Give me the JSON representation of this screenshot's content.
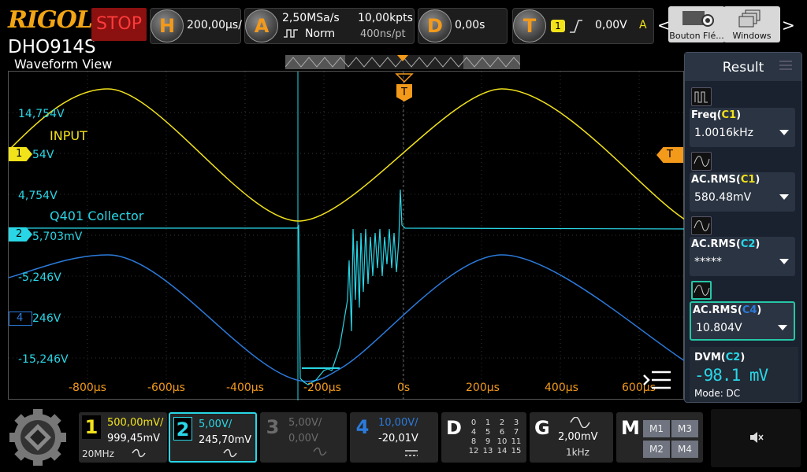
{
  "brand": "RIGOL",
  "model": "DHO914S",
  "run_state": "STOP",
  "horizontal": {
    "key": "H",
    "scale": "200,00µs/"
  },
  "acquire": {
    "key": "A",
    "sample_rate": "2,50MSa/s",
    "mode": "Norm",
    "points": "10,00kpts",
    "time_per_pt": "400ns/pt"
  },
  "delay": {
    "key": "D",
    "value": "0,00s"
  },
  "trigger": {
    "key": "T",
    "source": "1",
    "level": "0,00V",
    "sweep": "A"
  },
  "toolbar": {
    "left_arrow": "<",
    "right_arrow": ">",
    "tool_items": [
      {
        "label": "Bouton Flé..."
      },
      {
        "label": "Windows"
      }
    ]
  },
  "waveform_view": {
    "title": "Waveform View",
    "trigger_marker": "T",
    "trigger_level_marker": "T",
    "labels": {
      "input": "INPUT",
      "collector": "Q401 Collector"
    },
    "y_labels": [
      "14,754V",
      "4,754V",
      "-5,246V",
      "-15,246V"
    ],
    "y_label_partials": [
      "54V",
      "5,703mV",
      "246V"
    ],
    "channel_markers": [
      "1",
      "2",
      "4"
    ],
    "x_labels": [
      "-800µs",
      "-600µs",
      "-400µs",
      "-200µs",
      "0s",
      "200µs",
      "400µs",
      "600µs"
    ]
  },
  "result_panel": {
    "title": "Result",
    "measurements": [
      {
        "name": "Freq",
        "channel": "C1",
        "value": "1.0016kHz",
        "color": "#f2e21a"
      },
      {
        "name": "AC.RMS",
        "channel": "C1",
        "value": "580.48mV",
        "color": "#f2e21a"
      },
      {
        "name": "AC.RMS",
        "channel": "C2",
        "value": "*****",
        "color": "#29d6e6"
      },
      {
        "name": "AC.RMS",
        "channel": "C4",
        "value": "10.804V",
        "color": "#2b7bdc"
      }
    ],
    "dvm": {
      "name": "DVM",
      "channel": "C2",
      "value": "-98.1 mV",
      "mode": "Mode: DC"
    }
  },
  "channels": [
    {
      "num": "1",
      "scale": "500,00mV/",
      "offset": "999,45mV",
      "bandwidth": "20MHz",
      "color": "#f2e21a"
    },
    {
      "num": "2",
      "scale": "5,00V/",
      "offset": "245,70mV",
      "color": "#29d6e6"
    },
    {
      "num": "3",
      "scale": "5,00V/",
      "offset": "0,00V",
      "color": "#6b6b6b"
    },
    {
      "num": "4",
      "scale": "10,00V/",
      "offset": "-20,01V",
      "color": "#2b7bdc"
    }
  ],
  "digital": {
    "key": "D",
    "bits": [
      [
        "0",
        "1",
        "2",
        "3"
      ],
      [
        "4",
        "5",
        "6",
        "7"
      ],
      [
        "8",
        "9",
        "10",
        "11"
      ],
      [
        "12",
        "13",
        "14",
        "15"
      ]
    ]
  },
  "generator": {
    "key": "G",
    "amplitude": "2,00mV",
    "frequency": "1kHz"
  },
  "math": {
    "key": "M",
    "buttons": [
      "M1",
      "M3",
      "M2",
      "M4"
    ]
  },
  "colors": {
    "ch1": "#f2e21a",
    "ch2": "#29d6e6",
    "ch4": "#2b7bdc",
    "accent": "#f39a1b",
    "stop": "#ff3b3b"
  }
}
